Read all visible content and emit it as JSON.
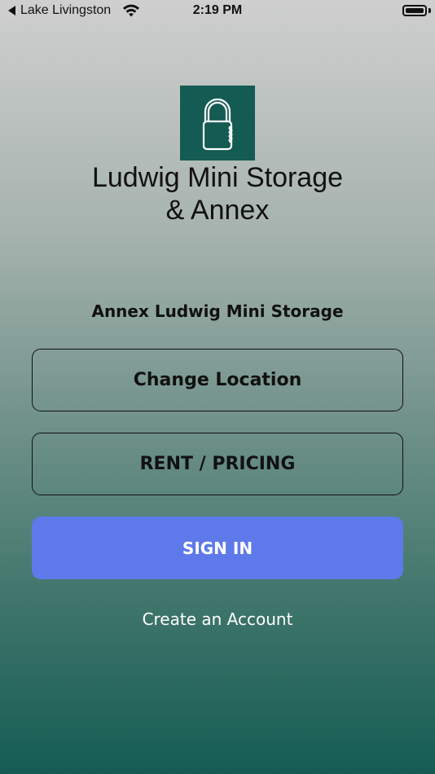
{
  "status_bar": {
    "back_label": "Lake Livingston",
    "time": "2:19 PM",
    "icons": [
      "back-arrow-icon",
      "wifi-icon",
      "battery-icon"
    ]
  },
  "brand": {
    "logo_icon": "padlock-icon",
    "name_line1": "Ludwig Mini Storage",
    "name_line2": "& Annex"
  },
  "location": {
    "name": "Annex Ludwig Mini Storage"
  },
  "actions": {
    "change_location": "Change Location",
    "rent_pricing": "RENT / PRICING",
    "sign_in": "SIGN IN",
    "create_account": "Create an Account"
  },
  "colors": {
    "brand_green": "#145c53",
    "sign_in_blue": "#5e79e9"
  }
}
